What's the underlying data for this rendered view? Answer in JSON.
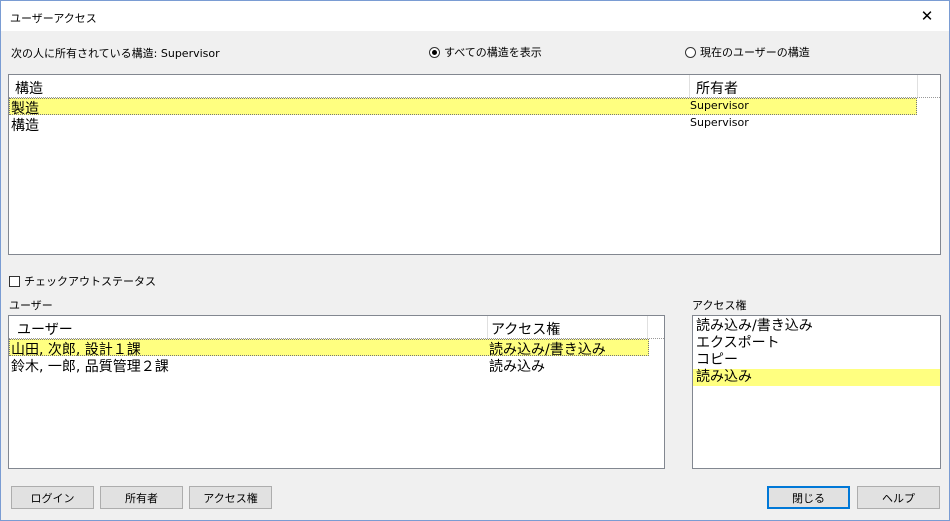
{
  "window": {
    "title": "ユーザーアクセス",
    "close_glyph": "✕"
  },
  "owner_label": "次の人に所有されている構造: Supervisor",
  "view_options": {
    "show_all": {
      "label": "すべての構造を表示",
      "checked": true
    },
    "current_user": {
      "label": "現在のユーザーの構造",
      "checked": false
    }
  },
  "structures": {
    "columns": [
      "構造",
      "所有者"
    ],
    "rows": [
      {
        "name": "製造",
        "owner": "Supervisor",
        "selected": true
      },
      {
        "name": "構造",
        "owner": "Supervisor",
        "selected": false
      }
    ]
  },
  "checkout_status": {
    "label": "チェックアウトステータス",
    "checked": false
  },
  "users": {
    "section_label": "ユーザー",
    "columns": [
      "ユーザー",
      "アクセス権"
    ],
    "rows": [
      {
        "name": "山田, 次郎, 設計１課",
        "access": "読み込み/書き込み",
        "selected": true
      },
      {
        "name": "鈴木, 一郎, 品質管理２課",
        "access": "読み込み",
        "selected": false
      }
    ]
  },
  "access_rights": {
    "section_label": "アクセス権",
    "items": [
      {
        "label": "読み込み/書き込み",
        "selected": false
      },
      {
        "label": "エクスポート",
        "selected": false
      },
      {
        "label": "コピー",
        "selected": false
      },
      {
        "label": "読み込み",
        "selected": true
      }
    ]
  },
  "buttons": {
    "login": "ログイン",
    "owner": "所有者",
    "access": "アクセス権",
    "close": "閉じる",
    "help": "ヘルプ"
  }
}
